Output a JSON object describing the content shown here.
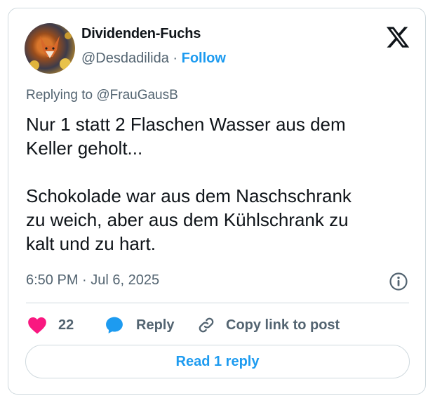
{
  "author": {
    "display_name": "Dividenden-Fuchs",
    "handle": "@Desdadilida",
    "separator": "·",
    "follow_label": "Follow",
    "avatar_icon": "fox-avatar"
  },
  "platform_icon": "x-logo-icon",
  "reply_context": {
    "prefix": "Replying to ",
    "mention": "@FrauGausB"
  },
  "tweet": {
    "text": "Nur 1 statt 2 Flaschen Wasser aus dem\nKeller geholt...\n\nSchokolade war aus dem Naschschrank\nzu weich, aber aus dem Kühlschrank zu\nkalt und zu hart.",
    "timestamp": "6:50 PM · Jul 6, 2025"
  },
  "actions": {
    "like_count": "22",
    "reply_label": "Reply",
    "copy_link_label": "Copy link to post"
  },
  "read_replies_label": "Read 1 reply",
  "colors": {
    "accent": "#1d9bf0",
    "like": "#f91880",
    "secondary_text": "#536471",
    "border": "#cfd9de"
  }
}
